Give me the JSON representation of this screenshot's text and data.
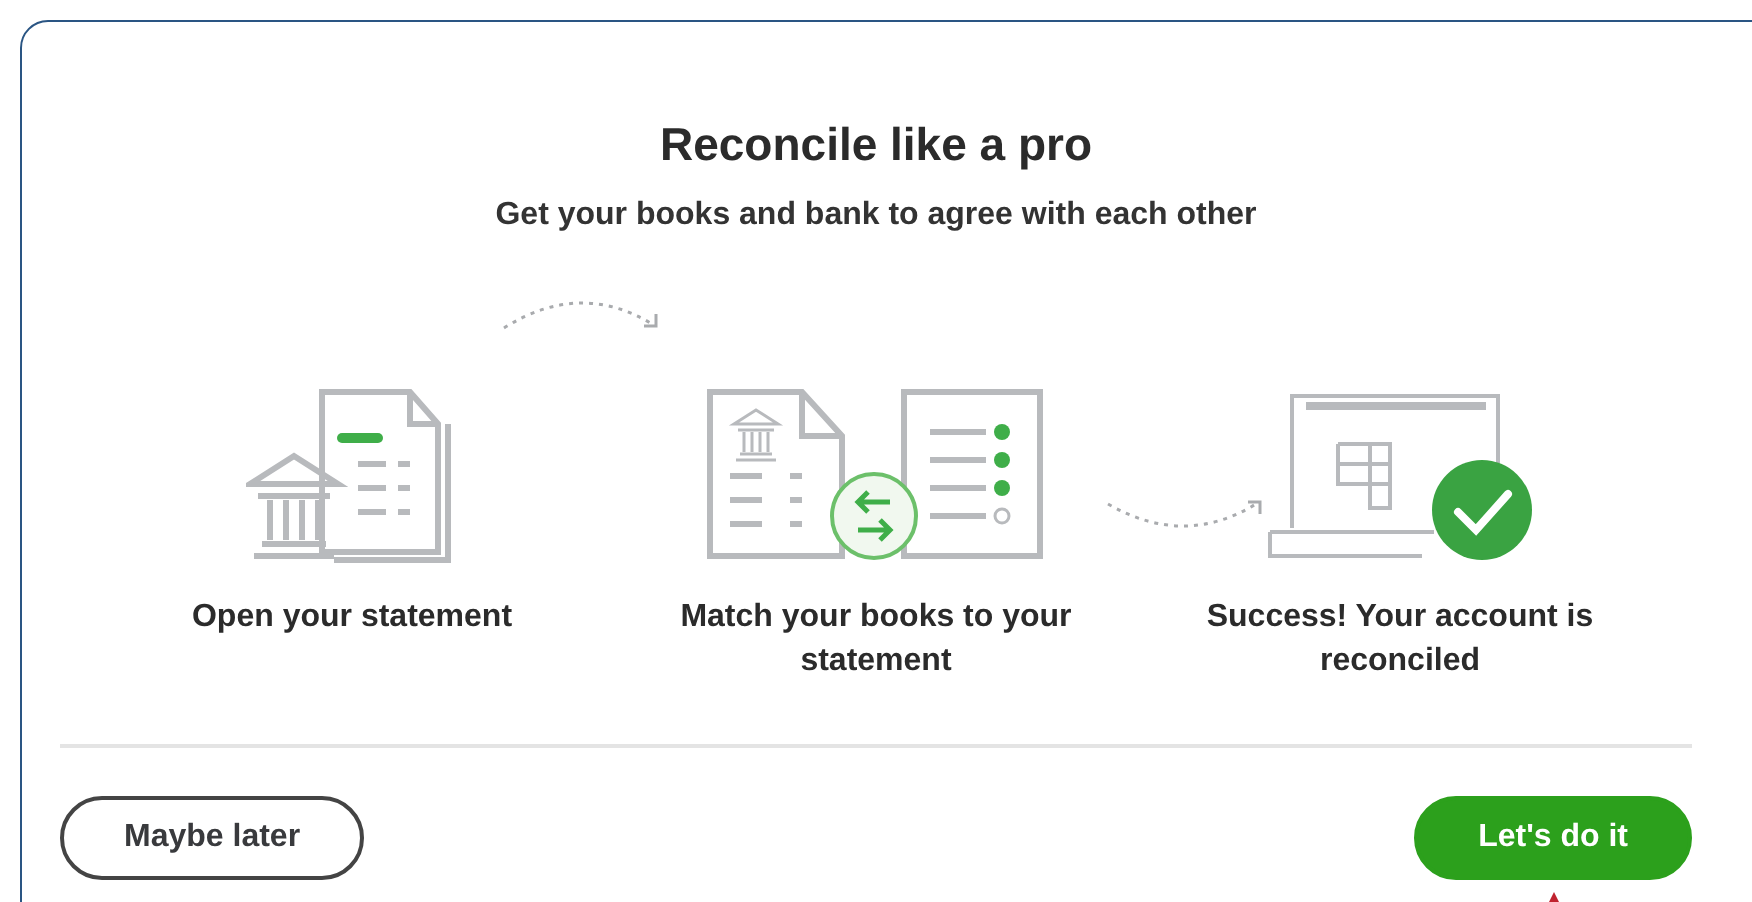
{
  "dialog": {
    "title": "Reconcile like a pro",
    "subtitle": "Get your books and bank to agree with each other"
  },
  "steps": [
    {
      "kind": "statement",
      "label": "Open your statement"
    },
    {
      "kind": "match",
      "label": "Match your books to your statement"
    },
    {
      "kind": "success",
      "label": "Success! Your account is reconciled"
    }
  ],
  "buttons": [
    {
      "label": "Maybe later",
      "kind": "secondary"
    },
    {
      "label": "Let's do it",
      "kind": "primary"
    }
  ]
}
